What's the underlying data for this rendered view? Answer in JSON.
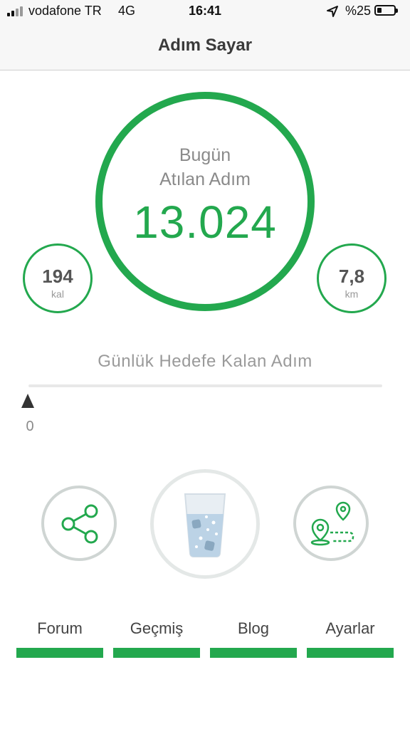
{
  "status_bar": {
    "carrier": "vodafone TR",
    "network": "4G",
    "time": "16:41",
    "battery": "%25",
    "icons": [
      "signal-icon",
      "location-arrow-icon",
      "battery-icon"
    ]
  },
  "nav": {
    "title": "Adım Sayar"
  },
  "today": {
    "label_line1": "Bugün",
    "label_line2": "Atılan Adım",
    "steps": "13.024"
  },
  "calories": {
    "value": "194",
    "unit": "kal"
  },
  "distance": {
    "value": "7,8",
    "unit": "km"
  },
  "goal": {
    "label": "Günlük Hedefe Kalan Adım",
    "remaining": "0",
    "progress_fraction": 0
  },
  "actions": [
    {
      "icon": "share-icon"
    },
    {
      "icon": "water-glass-icon"
    },
    {
      "icon": "route-map-icon"
    }
  ],
  "tabs": [
    {
      "label": "Forum"
    },
    {
      "label": "Geçmiş"
    },
    {
      "label": "Blog"
    },
    {
      "label": "Ayarlar"
    }
  ],
  "colors": {
    "accent": "#23a84e",
    "ring_gray": "#cfd5d3",
    "text_gray": "#8a8a8a"
  }
}
